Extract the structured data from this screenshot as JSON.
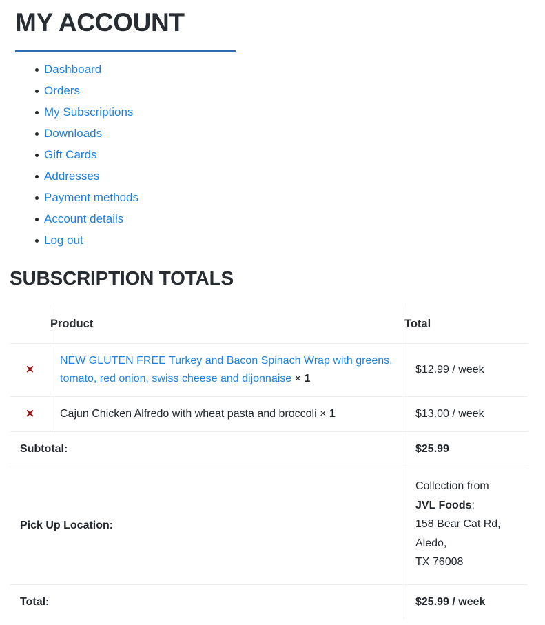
{
  "account": {
    "title": "MY ACCOUNT",
    "nav": [
      {
        "label": "Dashboard"
      },
      {
        "label": "Orders"
      },
      {
        "label": "My Subscriptions"
      },
      {
        "label": "Downloads"
      },
      {
        "label": "Gift Cards"
      },
      {
        "label": "Addresses"
      },
      {
        "label": "Payment methods"
      },
      {
        "label": "Account details"
      },
      {
        "label": "Log out"
      }
    ]
  },
  "totals": {
    "title": "SUBSCRIPTION TOTALS",
    "columns": {
      "remove": "",
      "product": "Product",
      "total": "Total"
    },
    "remove_icon": "×",
    "items": [
      {
        "name": "NEW GLUTEN FREE Turkey and Bacon Spinach Wrap with greens, tomato, red onion, swiss cheese and dijonnaise",
        "quantity_symbol": "×",
        "quantity": "1",
        "total": "$12.99 / week",
        "is_link": true
      },
      {
        "name": "Cajun Chicken Alfredo with wheat pasta and broccoli",
        "quantity_symbol": "×",
        "quantity": "1",
        "total": "$13.00 / week",
        "is_link": false
      }
    ],
    "subtotal": {
      "label": "Subtotal:",
      "value": "$25.99"
    },
    "pickup": {
      "label": "Pick Up Location:",
      "line1": "Collection from",
      "shop": "JVL Foods",
      "shop_suffix": ":",
      "line2": "158 Bear Cat Rd,",
      "line3": "Aledo,",
      "line4": "TX 76008"
    },
    "grand_total": {
      "label": "Total:",
      "value": "$25.99 / week"
    }
  },
  "colors": {
    "link": "#1d80e2",
    "rule": "#2d6cb0",
    "remove": "#a50e0e",
    "text": "#23282d",
    "border": "#ededed"
  }
}
